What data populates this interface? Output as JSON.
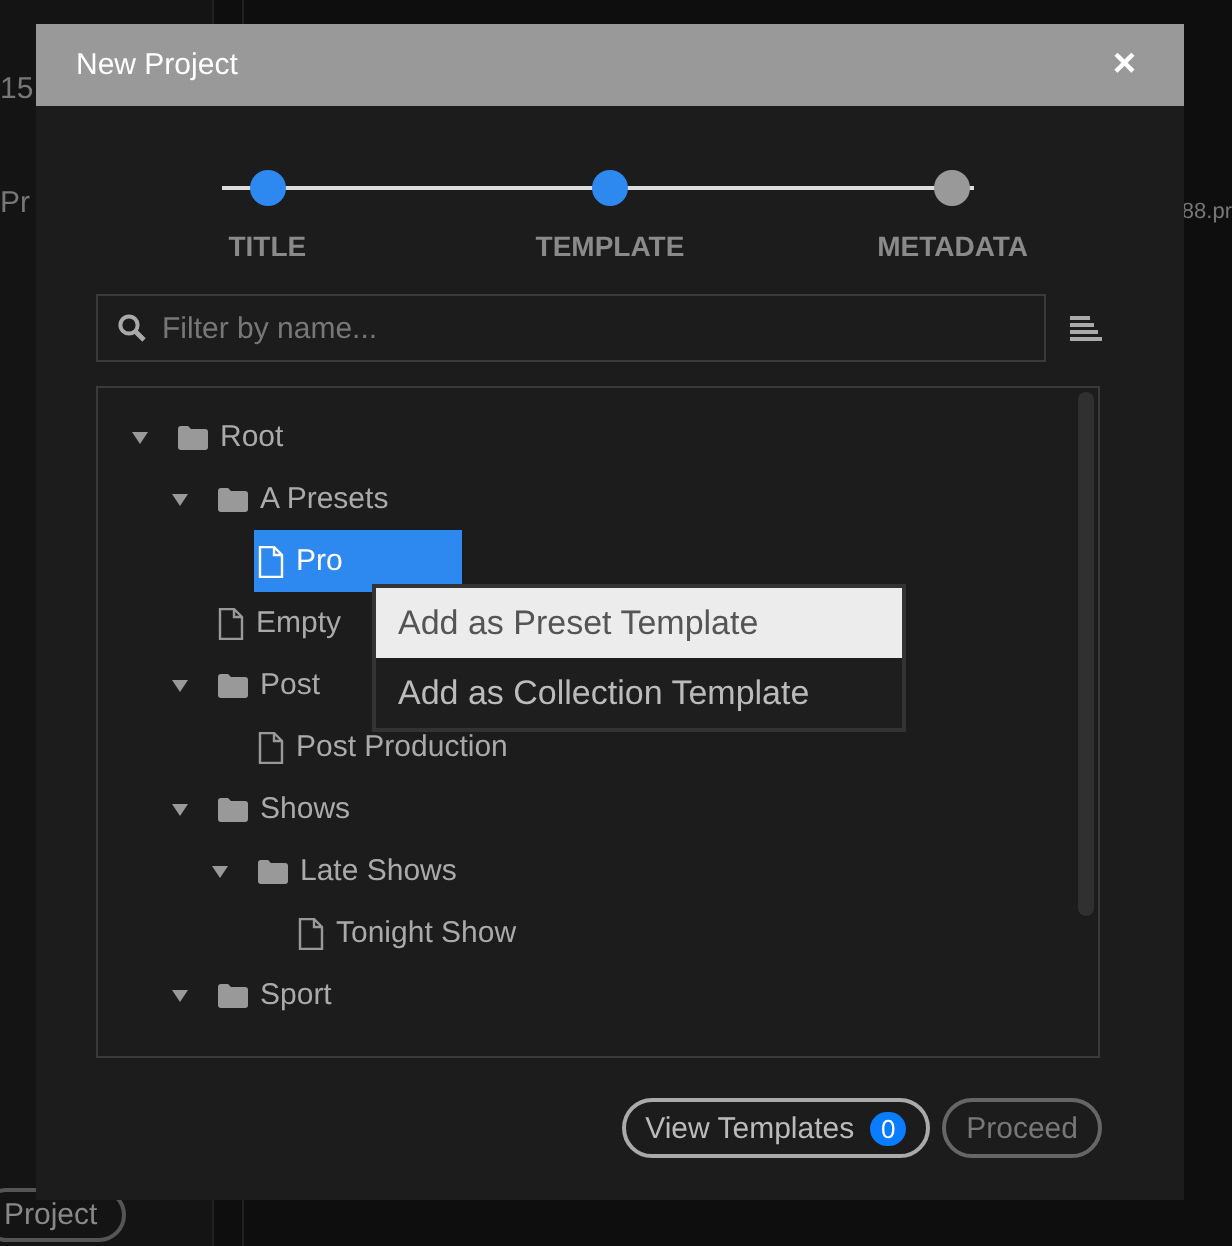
{
  "background": {
    "left_texts": [
      "15",
      "Pr"
    ],
    "right_text": "88.pr",
    "bottom_button": "Project"
  },
  "dialog": {
    "title": "New Project",
    "close": "×",
    "steps": [
      {
        "label": "TITLE",
        "done": true
      },
      {
        "label": "TEMPLATE",
        "done": true
      },
      {
        "label": "METADATA",
        "done": false
      }
    ],
    "filter": {
      "placeholder": "Filter by name..."
    },
    "tree": [
      {
        "kind": "folder",
        "label": "Root",
        "expanded": true,
        "selected": false,
        "children": [
          {
            "kind": "folder",
            "label": "A Presets",
            "expanded": true,
            "selected": false,
            "children": [
              {
                "kind": "file",
                "label": "Pro",
                "selected": true
              }
            ]
          },
          {
            "kind": "file",
            "label": "Empty",
            "selected": false
          },
          {
            "kind": "folder",
            "label": "Post",
            "expanded": true,
            "selected": false,
            "children": [
              {
                "kind": "file",
                "label": "Post Production",
                "selected": false
              }
            ]
          },
          {
            "kind": "folder",
            "label": "Shows",
            "expanded": true,
            "selected": false,
            "children": [
              {
                "kind": "folder",
                "label": "Late Shows",
                "expanded": true,
                "selected": false,
                "children": [
                  {
                    "kind": "file",
                    "label": "Tonight Show",
                    "selected": false
                  }
                ]
              }
            ]
          },
          {
            "kind": "folder",
            "label": "Sport",
            "expanded": true,
            "selected": false
          }
        ]
      }
    ],
    "context_menu": [
      {
        "label": "Add as Preset Template",
        "selected": true
      },
      {
        "label": "Add as Collection Template",
        "selected": false
      }
    ],
    "buttons": [
      {
        "label": "View Templates",
        "badge": "0",
        "disabled": false
      },
      {
        "label": "Proceed",
        "disabled": true
      }
    ]
  }
}
